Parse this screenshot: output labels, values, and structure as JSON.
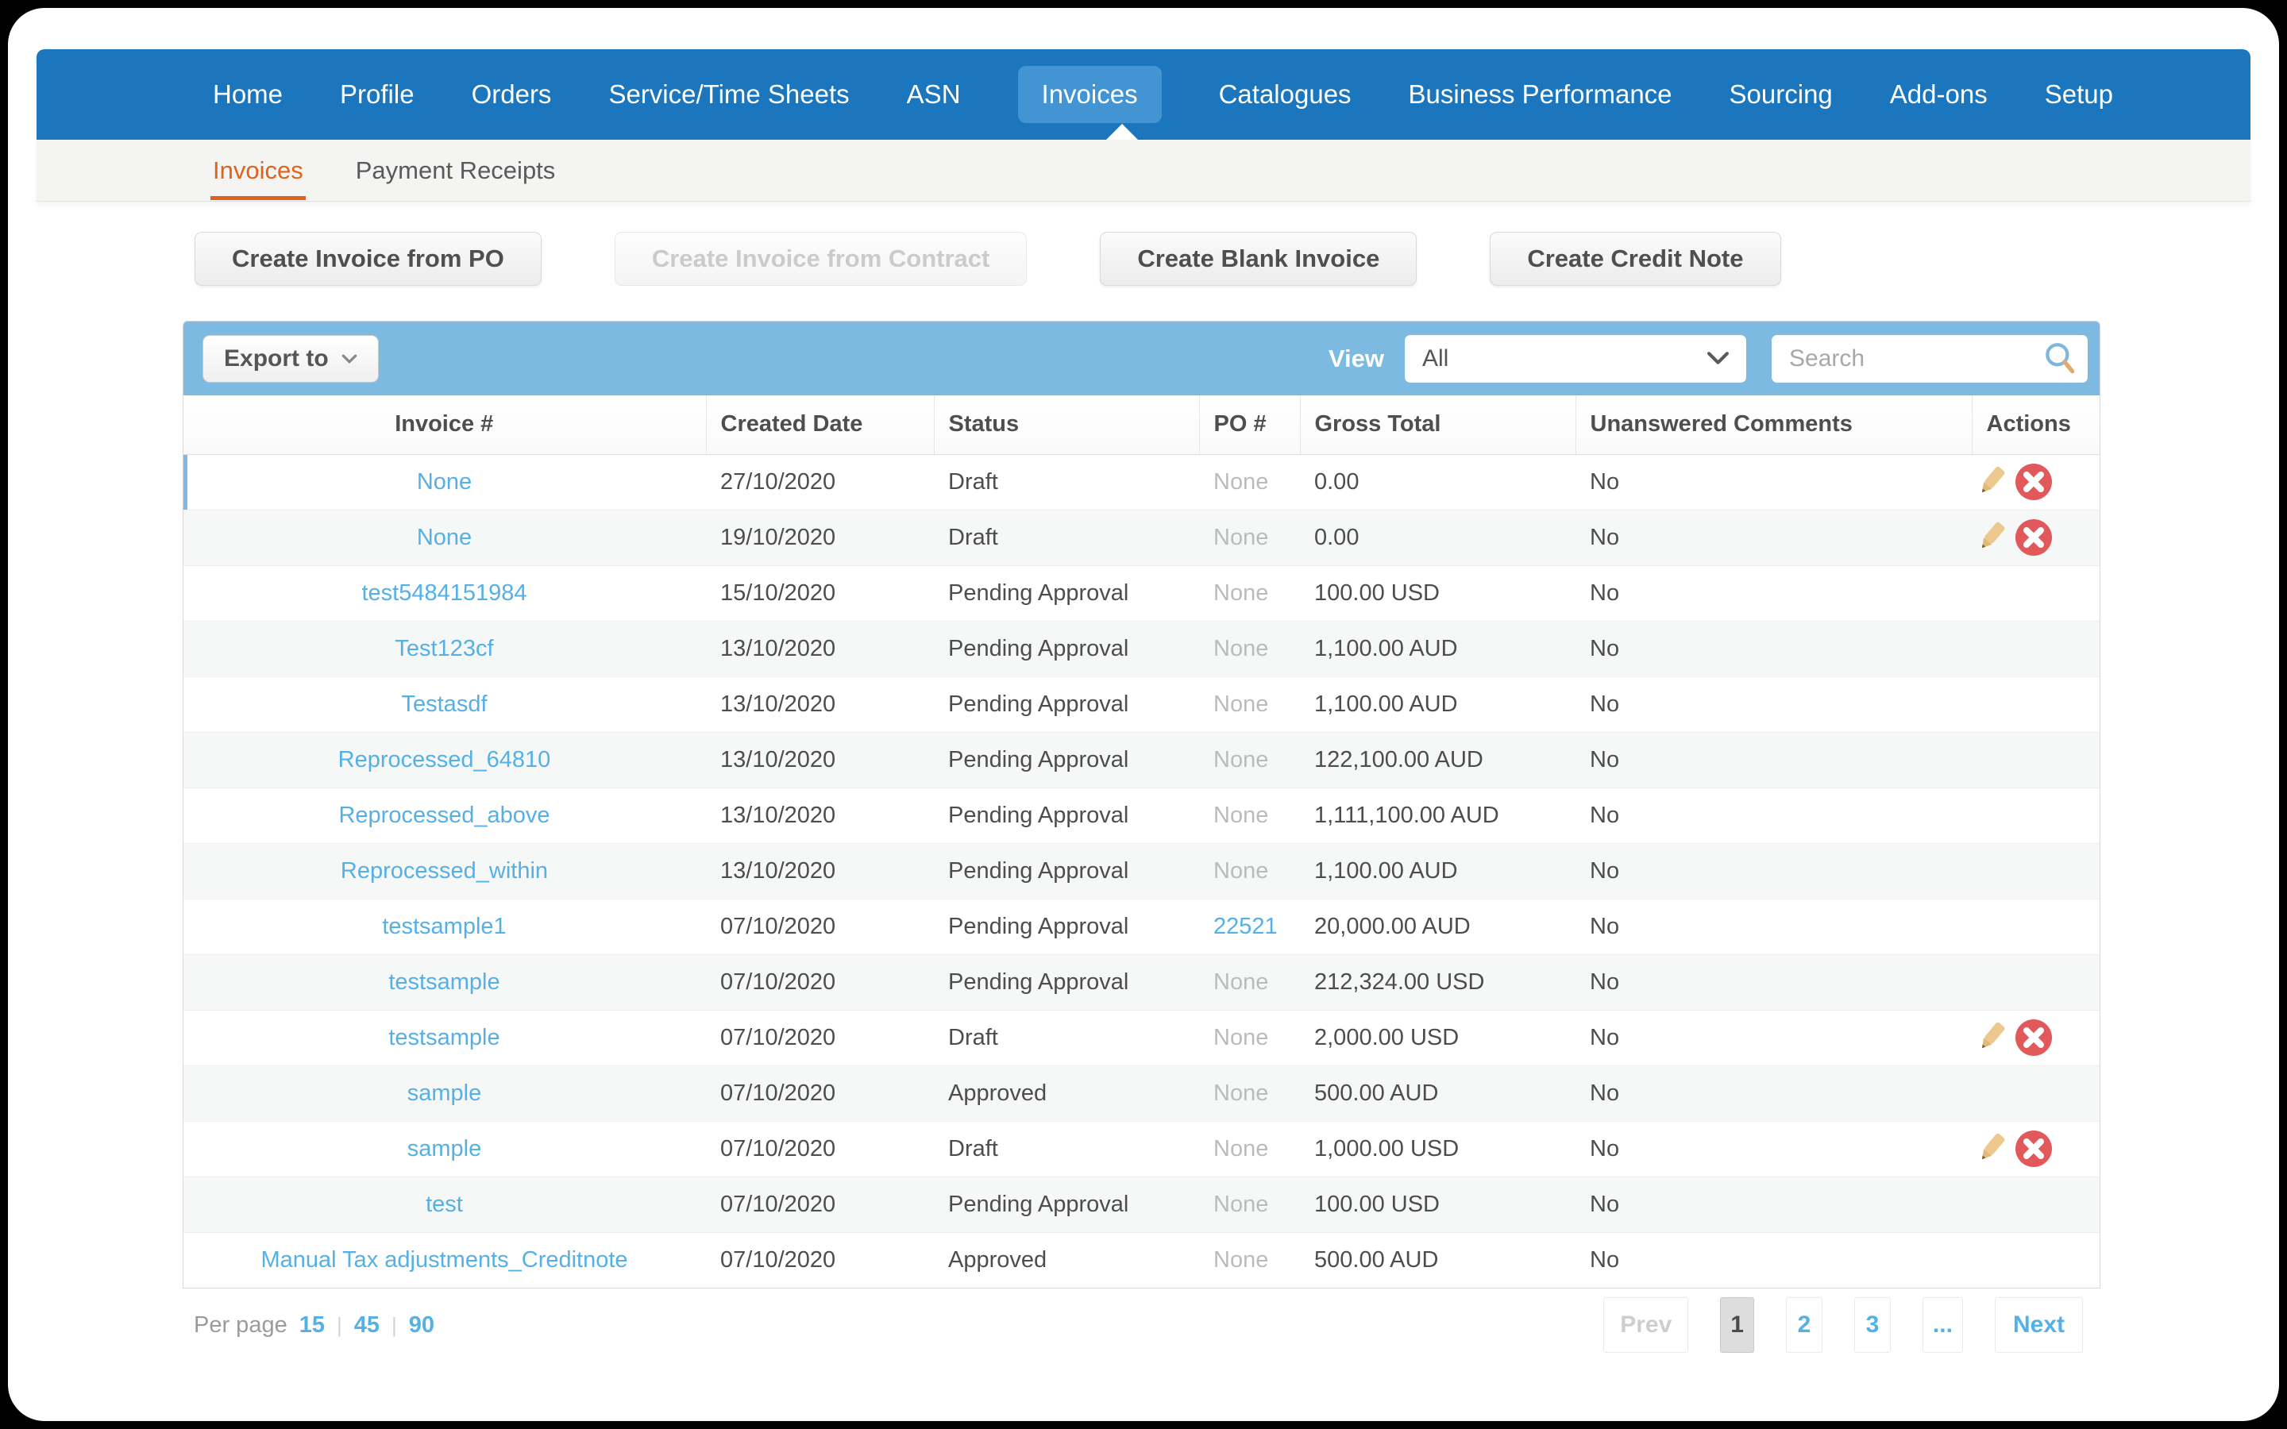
{
  "colors": {
    "nav_blue": "#1b76bd",
    "active_blue": "#4394d3",
    "toolbar_blue": "#7cbae1",
    "link_blue": "#55b0e6",
    "orange": "#e2611b",
    "row_alt": "#f6f7f7",
    "delete_red": "#e2595c",
    "pencil_tan": "#edc88e"
  },
  "nav": {
    "items": [
      "Home",
      "Profile",
      "Orders",
      "Service/Time Sheets",
      "ASN",
      "Invoices",
      "Catalogues",
      "Business Performance",
      "Sourcing",
      "Add-ons",
      "Setup"
    ],
    "active": "Invoices"
  },
  "subnav": {
    "items": [
      "Invoices",
      "Payment Receipts"
    ],
    "active": "Invoices"
  },
  "action_buttons": [
    {
      "label": "Create Invoice from PO",
      "enabled": true
    },
    {
      "label": "Create Invoice from Contract",
      "enabled": false
    },
    {
      "label": "Create Blank Invoice",
      "enabled": true
    },
    {
      "label": "Create Credit Note",
      "enabled": true
    }
  ],
  "toolbar": {
    "export_label": "Export to",
    "view_label": "View",
    "view_value": "All",
    "search_placeholder": "Search"
  },
  "table": {
    "columns": [
      "Invoice #",
      "Created Date",
      "Status",
      "PO #",
      "Gross Total",
      "Unanswered Comments",
      "Actions"
    ],
    "rows": [
      {
        "invoice": "None",
        "created": "27/10/2020",
        "status": "Draft",
        "po": "None",
        "po_link": false,
        "gross": "0.00",
        "comments": "No",
        "actions": true,
        "selected": true
      },
      {
        "invoice": "None",
        "created": "19/10/2020",
        "status": "Draft",
        "po": "None",
        "po_link": false,
        "gross": "0.00",
        "comments": "No",
        "actions": true
      },
      {
        "invoice": "test5484151984",
        "created": "15/10/2020",
        "status": "Pending Approval",
        "po": "None",
        "po_link": false,
        "gross": "100.00 USD",
        "comments": "No",
        "actions": false
      },
      {
        "invoice": "Test123cf",
        "created": "13/10/2020",
        "status": "Pending Approval",
        "po": "None",
        "po_link": false,
        "gross": "1,100.00 AUD",
        "comments": "No",
        "actions": false
      },
      {
        "invoice": "Testasdf",
        "created": "13/10/2020",
        "status": "Pending Approval",
        "po": "None",
        "po_link": false,
        "gross": "1,100.00 AUD",
        "comments": "No",
        "actions": false
      },
      {
        "invoice": "Reprocessed_64810",
        "created": "13/10/2020",
        "status": "Pending Approval",
        "po": "None",
        "po_link": false,
        "gross": "122,100.00 AUD",
        "comments": "No",
        "actions": false
      },
      {
        "invoice": "Reprocessed_above",
        "created": "13/10/2020",
        "status": "Pending Approval",
        "po": "None",
        "po_link": false,
        "gross": "1,111,100.00 AUD",
        "comments": "No",
        "actions": false
      },
      {
        "invoice": "Reprocessed_within",
        "created": "13/10/2020",
        "status": "Pending Approval",
        "po": "None",
        "po_link": false,
        "gross": "1,100.00 AUD",
        "comments": "No",
        "actions": false
      },
      {
        "invoice": "testsample1",
        "created": "07/10/2020",
        "status": "Pending Approval",
        "po": "22521",
        "po_link": true,
        "gross": "20,000.00 AUD",
        "comments": "No",
        "actions": false
      },
      {
        "invoice": "testsample",
        "created": "07/10/2020",
        "status": "Pending Approval",
        "po": "None",
        "po_link": false,
        "gross": "212,324.00 USD",
        "comments": "No",
        "actions": false
      },
      {
        "invoice": "testsample",
        "created": "07/10/2020",
        "status": "Draft",
        "po": "None",
        "po_link": false,
        "gross": "2,000.00 USD",
        "comments": "No",
        "actions": true
      },
      {
        "invoice": "sample",
        "created": "07/10/2020",
        "status": "Approved",
        "po": "None",
        "po_link": false,
        "gross": "500.00 AUD",
        "comments": "No",
        "actions": false
      },
      {
        "invoice": "sample",
        "created": "07/10/2020",
        "status": "Draft",
        "po": "None",
        "po_link": false,
        "gross": "1,000.00 USD",
        "comments": "No",
        "actions": true
      },
      {
        "invoice": "test",
        "created": "07/10/2020",
        "status": "Pending Approval",
        "po": "None",
        "po_link": false,
        "gross": "100.00 USD",
        "comments": "No",
        "actions": false
      },
      {
        "invoice": "Manual Tax adjustments_Creditnote",
        "created": "07/10/2020",
        "status": "Approved",
        "po": "None",
        "po_link": false,
        "gross": "500.00 AUD",
        "comments": "No",
        "actions": false
      }
    ]
  },
  "pagination": {
    "per_page_label": "Per page",
    "options": [
      "15",
      "45",
      "90"
    ],
    "prev": "Prev",
    "pages": [
      "1",
      "2",
      "3",
      "..."
    ],
    "current": "1",
    "next": "Next"
  }
}
